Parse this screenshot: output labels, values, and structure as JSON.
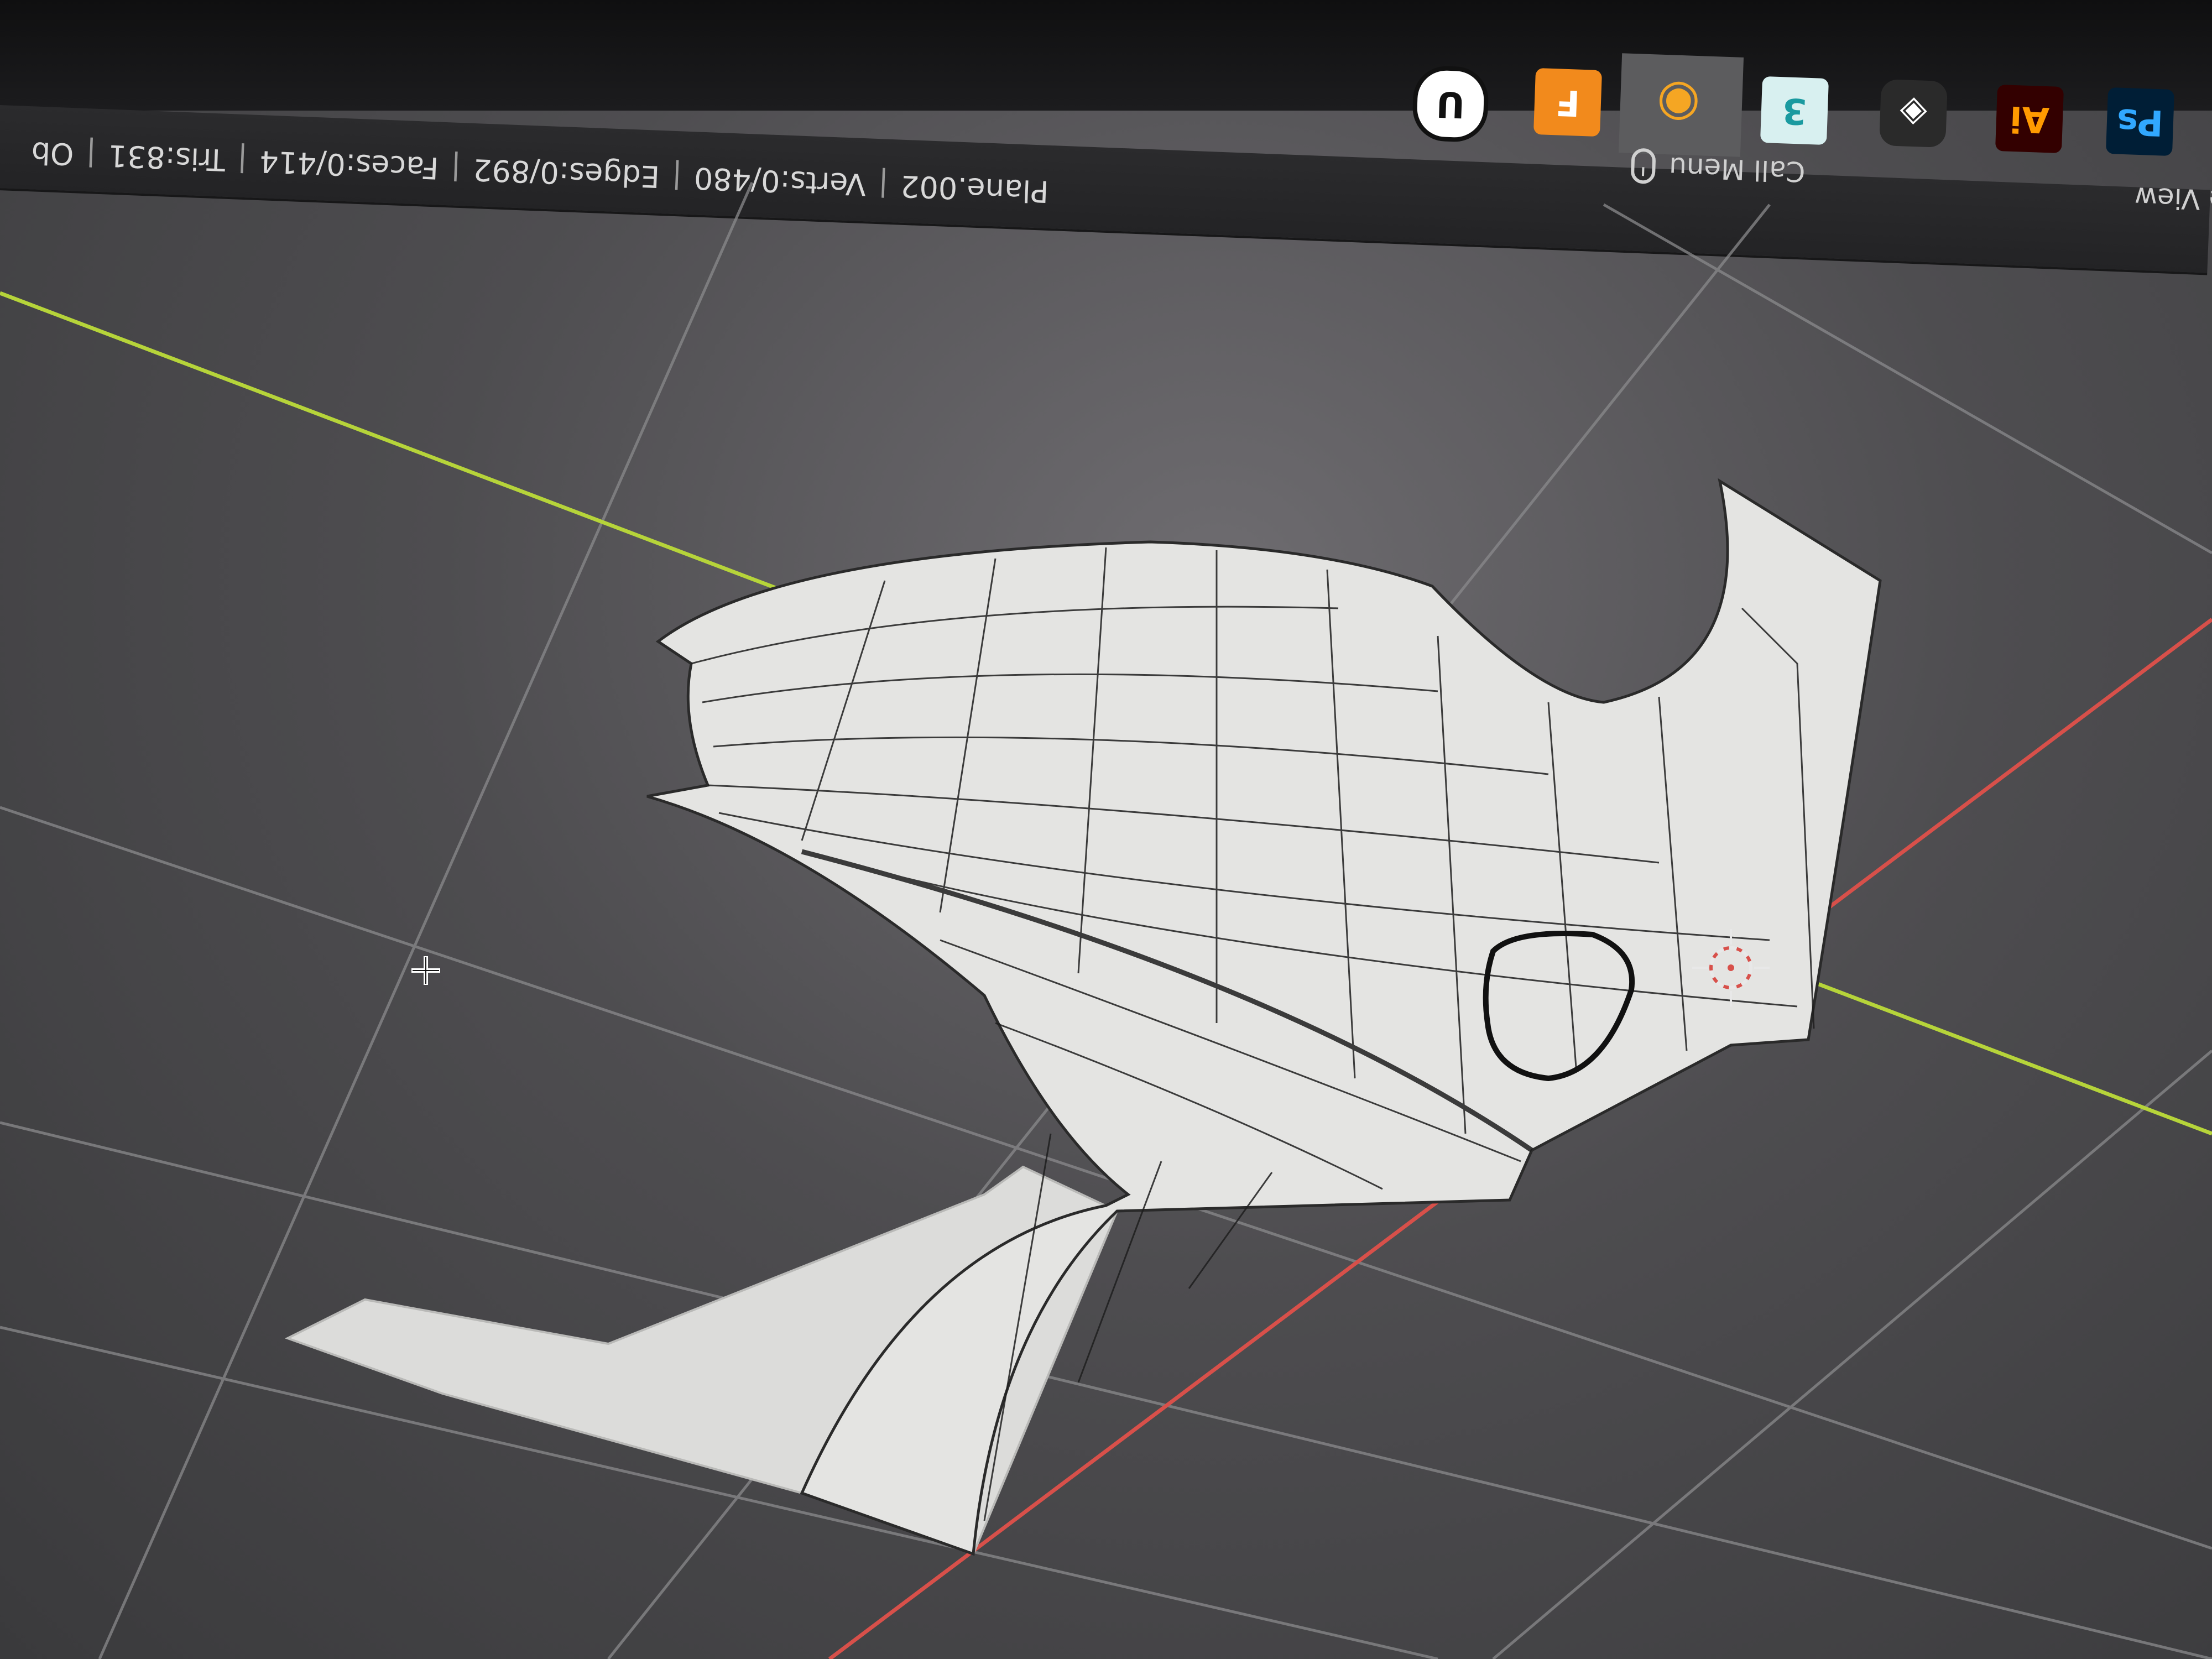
{
  "statusbar": {
    "object_name": "Plane.002",
    "verts": "Verts:0/480",
    "edges": "Edges:0/892",
    "faces": "Faces:0/414",
    "tris": "Tris:831",
    "trailing": "Ob",
    "separator": "|",
    "call_menu": "Call Menu",
    "view_label": "e View"
  },
  "taskbar": {
    "apps": [
      {
        "name": "unreal-engine-icon",
        "glyph": "U"
      },
      {
        "name": "fusion-360-icon",
        "glyph": "F"
      },
      {
        "name": "blender-icon",
        "glyph": "◉"
      },
      {
        "name": "3-app-icon",
        "glyph": "3"
      },
      {
        "name": "davinci-resolve-icon",
        "glyph": "◈"
      },
      {
        "name": "illustrator-icon",
        "glyph": "Ai"
      },
      {
        "name": "photoshop-icon",
        "glyph": "Ps"
      }
    ]
  },
  "colors": {
    "axis_y": "#b6d43a",
    "axis_x": "#d8504a",
    "grid": "#8a8a8c",
    "mesh_fill": "#e4e4e2",
    "mesh_wire": "#1e1e1e"
  }
}
